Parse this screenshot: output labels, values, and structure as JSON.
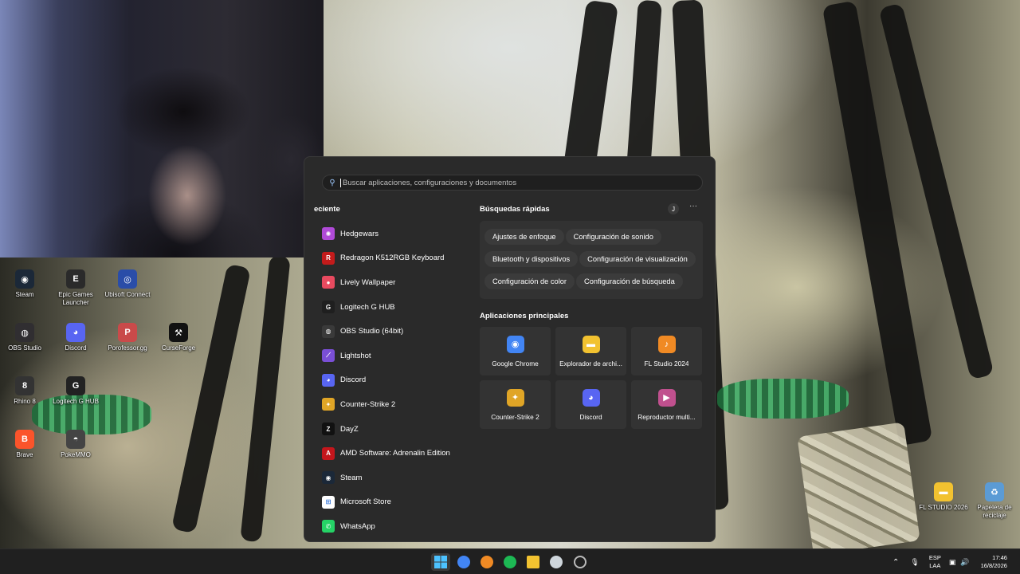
{
  "desktop": {
    "left_icons": [
      {
        "label": "Steam",
        "icon": "steam-icon",
        "color": "#1b2838",
        "glyph": "◉"
      },
      {
        "label": "Epic Games Launcher",
        "icon": "epic-games-icon",
        "color": "#2a2a2a",
        "glyph": "E"
      },
      {
        "label": "Ubisoft Connect",
        "icon": "ubisoft-icon",
        "color": "#2a4da8",
        "glyph": "◎"
      },
      {
        "label": "OBS Studio",
        "icon": "obs-icon",
        "color": "#302e31",
        "glyph": "◍"
      },
      {
        "label": "Discord",
        "icon": "discord-icon",
        "color": "#5865f2",
        "glyph": "◕"
      },
      {
        "label": "Porofessor.gg",
        "icon": "porofessor-icon",
        "color": "#c94a4a",
        "glyph": "P"
      },
      {
        "label": "CurseForge",
        "icon": "curseforge-icon",
        "color": "#111111",
        "glyph": "⚒"
      },
      {
        "label": "Rhino 8",
        "icon": "rhino-icon",
        "color": "#333333",
        "glyph": "8"
      },
      {
        "label": "Logitech G HUB",
        "icon": "logitech-icon",
        "color": "#222222",
        "glyph": "G"
      },
      {
        "label": "Brave",
        "icon": "brave-icon",
        "color": "#fb542b",
        "glyph": "B"
      },
      {
        "label": "PokeMMO",
        "icon": "pokemmo-icon",
        "color": "#444444",
        "glyph": "◓"
      }
    ],
    "right_icons": [
      {
        "label": "FL STUDIO 2026",
        "icon": "folder-icon",
        "color": "#f2c230",
        "glyph": "▬"
      },
      {
        "label": "Papelera de reciclaje",
        "icon": "recycle-bin-icon",
        "color": "#5b9bd5",
        "glyph": "♻"
      }
    ]
  },
  "start_menu": {
    "search_placeholder": "Buscar aplicaciones, configuraciones y documentos",
    "recent_title": "eciente",
    "recent_apps": [
      {
        "label": "Hedgewars",
        "icon": "hedgewars-icon",
        "color": "#b04ad8",
        "glyph": "✺"
      },
      {
        "label": "Redragon K512RGB Keyboard",
        "icon": "redragon-icon",
        "color": "#c31b1b",
        "glyph": "R"
      },
      {
        "label": "Lively Wallpaper",
        "icon": "lively-icon",
        "color": "#e84a5f",
        "glyph": "●"
      },
      {
        "label": "Logitech G HUB",
        "icon": "logitech-icon",
        "color": "#1f1f1f",
        "glyph": "G"
      },
      {
        "label": "OBS Studio (64bit)",
        "icon": "obs-icon",
        "color": "#3a3a3a",
        "glyph": "◍"
      },
      {
        "label": "Lightshot",
        "icon": "lightshot-icon",
        "color": "#7a4fd6",
        "glyph": "⟋"
      },
      {
        "label": "Discord",
        "icon": "discord-icon",
        "color": "#5865f2",
        "glyph": "◕"
      },
      {
        "label": "Counter-Strike 2",
        "icon": "cs2-icon",
        "color": "#e0a526",
        "glyph": "✦"
      },
      {
        "label": "DayZ",
        "icon": "dayz-icon",
        "color": "#111111",
        "glyph": "Z"
      },
      {
        "label": "AMD Software: Adrenalin Edition",
        "icon": "amd-icon",
        "color": "#c4161c",
        "glyph": "A"
      },
      {
        "label": "Steam",
        "icon": "steam-icon",
        "color": "#1b2838",
        "glyph": "◉"
      },
      {
        "label": "Microsoft Store",
        "icon": "microsoft-store-icon",
        "color": "#ffffff",
        "glyph": "⊞"
      },
      {
        "label": "WhatsApp",
        "icon": "whatsapp-icon",
        "color": "#25d366",
        "glyph": "✆"
      }
    ],
    "quick_title": "Búsquedas rápidas",
    "user_initial": "J",
    "more_label": "···",
    "quick_searches": [
      "Ajustes de enfoque",
      "Configuración de sonido",
      "Bluetooth y dispositivos",
      "Configuración de visualización",
      "Configuración de color",
      "Configuración de búsqueda"
    ],
    "top_title": "Aplicaciones principales",
    "top_apps": [
      {
        "label": "Google Chrome",
        "icon": "chrome-icon",
        "color": "#4285f4",
        "glyph": "◉"
      },
      {
        "label": "Explorador de archi...",
        "icon": "file-explorer-icon",
        "color": "#f2c230",
        "glyph": "▬"
      },
      {
        "label": "FL Studio 2024",
        "icon": "fl-studio-icon",
        "color": "#f08a24",
        "glyph": "♪"
      },
      {
        "label": "Counter-Strike 2",
        "icon": "cs2-icon",
        "color": "#e0a526",
        "glyph": "✦"
      },
      {
        "label": "Discord",
        "icon": "discord-icon",
        "color": "#5865f2",
        "glyph": "◕"
      },
      {
        "label": "Reproductor multi...",
        "icon": "media-player-icon",
        "color": "#c0508e",
        "glyph": "▶"
      }
    ]
  },
  "taskbar": {
    "apps": [
      {
        "name": "start",
        "icon": "windows-start-icon",
        "color": "#4cc2ff"
      },
      {
        "name": "chrome",
        "icon": "chrome-icon",
        "color": "#4285f4"
      },
      {
        "name": "fl-studio",
        "icon": "fl-studio-icon",
        "color": "#f08a24"
      },
      {
        "name": "spotify",
        "icon": "spotify-icon",
        "color": "#1db954"
      },
      {
        "name": "file-explorer",
        "icon": "file-explorer-icon",
        "color": "#f2c230"
      },
      {
        "name": "ccleaner",
        "icon": "ccleaner-icon",
        "color": "#cfd6dc"
      },
      {
        "name": "obs",
        "icon": "obs-icon",
        "color": "#bbbbbb"
      }
    ],
    "lang_top": "ESP",
    "lang_bottom": "LAA",
    "time": "17:46",
    "date": "16/8/2026"
  }
}
